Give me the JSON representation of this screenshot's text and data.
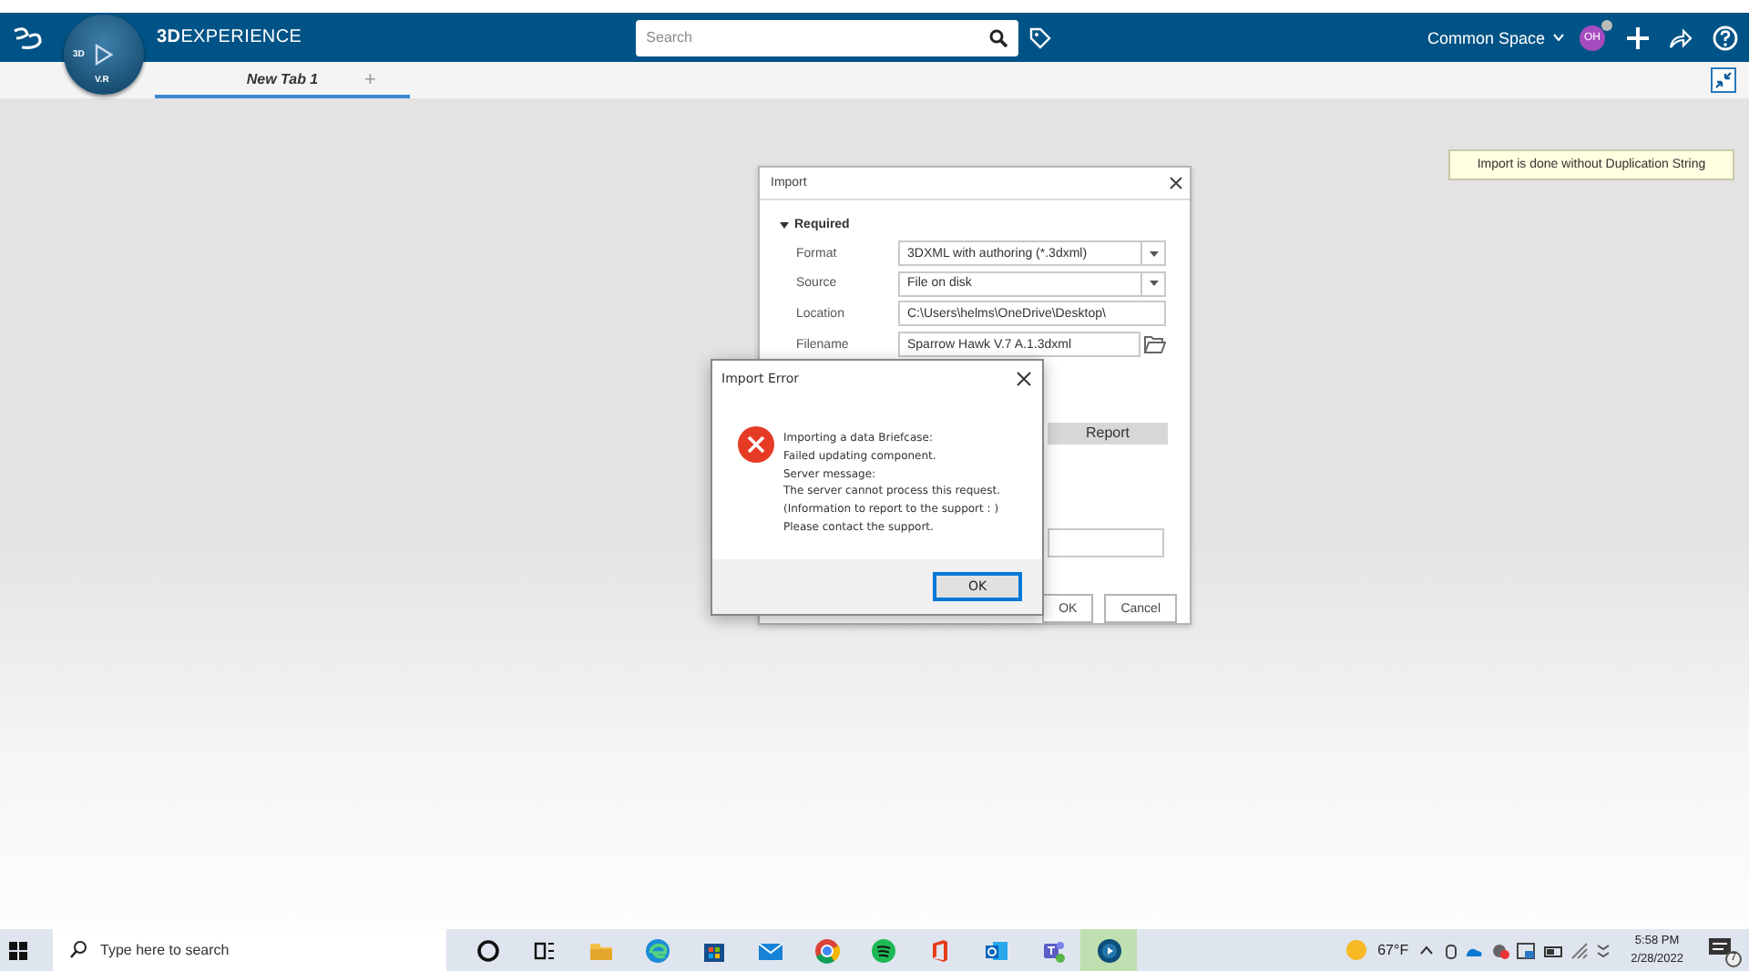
{
  "header": {
    "brand": "**3D**EXPERIENCE",
    "compass": [
      "3D",
      "V.R"
    ],
    "search": {
      "placeholder": "Search"
    },
    "space": "Common Space",
    "avatar": "OH"
  },
  "tabs": [
    {
      "label": "New Tab 1",
      "selected": true
    }
  ],
  "add_tab": "+",
  "toast": "Import is done without Duplication String",
  "import_dialog": {
    "title": "Import",
    "section": {
      "label": "Required",
      "expanded": true
    },
    "fields": [
      {
        "label": "Format",
        "value": "3DXML with authoring (*.3dxml)",
        "kind": "dropdown"
      },
      {
        "label": "Source",
        "value": "File on disk",
        "kind": "dropdown"
      },
      {
        "label": "Location",
        "value": "C:\\Users\\helms\\OneDrive\\Desktop\\",
        "kind": "text"
      },
      {
        "label": "Filename",
        "value": "Sparrow Hawk V.7 A.1.3dxml",
        "kind": "file"
      }
    ],
    "report": "Report",
    "buttons": [
      "OK",
      "Cancel"
    ]
  },
  "error_dialog": {
    "title": "Import Error",
    "lines": [
      "Importing a data Briefcase:",
      "Failed updating component.",
      "Server message:",
      "The server cannot process this request.",
      "(Information to report to the support : )",
      "Please contact the support."
    ],
    "button": "OK"
  },
  "taskbar": {
    "search_placeholder": "Type here to search",
    "apps": [
      {
        "kind": "cortana",
        "selected": false
      },
      {
        "kind": "taskview",
        "selected": false
      },
      {
        "kind": "explorer",
        "selected": false
      },
      {
        "kind": "edge",
        "selected": false
      },
      {
        "kind": "store",
        "selected": false
      },
      {
        "kind": "mail",
        "selected": false
      },
      {
        "kind": "chrome",
        "selected": false
      },
      {
        "kind": "spotify",
        "selected": false
      },
      {
        "kind": "office",
        "selected": false
      },
      {
        "kind": "outlook",
        "selected": false
      },
      {
        "kind": "teams",
        "selected": false
      },
      {
        "kind": "globe",
        "selected": true
      }
    ],
    "weather": "67°F",
    "time": "5:58 PM",
    "date": "2/28/2022",
    "notifications": "7"
  }
}
